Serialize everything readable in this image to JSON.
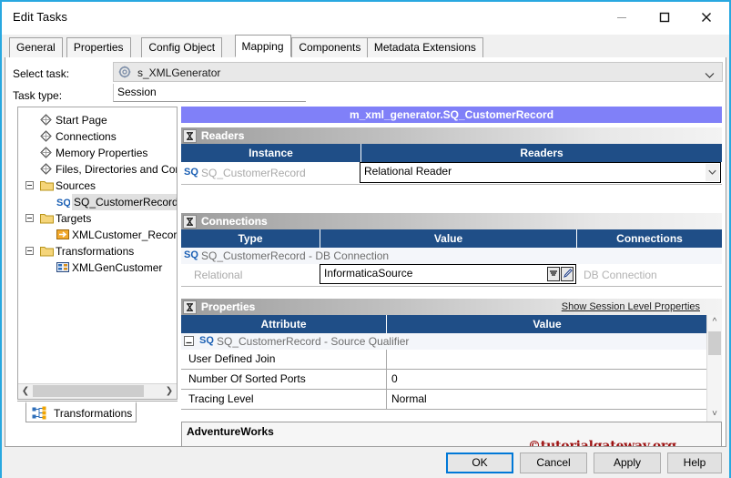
{
  "window": {
    "title": "Edit Tasks",
    "controls": {
      "minimize": "Minimize",
      "maximize": "Maximize",
      "close": "Close"
    }
  },
  "tabs": [
    {
      "label": "General",
      "active": false
    },
    {
      "label": "Properties",
      "active": false
    },
    {
      "label": "Config Object",
      "active": false
    },
    {
      "label": "Mapping",
      "active": true
    },
    {
      "label": "Components",
      "active": false
    },
    {
      "label": "Metadata Extensions",
      "active": false
    }
  ],
  "form": {
    "select_task_label": "Select task:",
    "select_task_value": "s_XMLGenerator",
    "task_type_label": "Task type:",
    "task_type_value": "Session"
  },
  "tree": {
    "items": [
      {
        "label": "Start Page",
        "indent": 0,
        "icon": "diamond-icon",
        "expander": false,
        "selected": false
      },
      {
        "label": "Connections",
        "indent": 0,
        "icon": "diamond-icon",
        "expander": false,
        "selected": false
      },
      {
        "label": "Memory Properties",
        "indent": 0,
        "icon": "diamond-icon",
        "expander": false,
        "selected": false
      },
      {
        "label": "Files, Directories and Com",
        "indent": 0,
        "icon": "diamond-icon",
        "expander": false,
        "selected": false
      },
      {
        "label": "Sources",
        "indent": 0,
        "icon": "folder-icon",
        "expander": true,
        "selected": false
      },
      {
        "label": "SQ_CustomerRecord",
        "indent": 1,
        "icon": "sq-icon",
        "expander": false,
        "selected": true
      },
      {
        "label": "Targets",
        "indent": 0,
        "icon": "folder-icon",
        "expander": true,
        "selected": false
      },
      {
        "label": "XMLCustomer_Record",
        "indent": 1,
        "icon": "target-icon",
        "expander": false,
        "selected": false
      },
      {
        "label": "Transformations",
        "indent": 0,
        "icon": "folder-icon",
        "expander": true,
        "selected": false
      },
      {
        "label": "XMLGenCustomer",
        "indent": 1,
        "icon": "transform-icon",
        "expander": false,
        "selected": false
      }
    ],
    "bottom_tab": "Transformations"
  },
  "mapping": {
    "title": "m_xml_generator.SQ_CustomerRecord",
    "readers": {
      "section_title": "Readers",
      "columns": [
        "Instance",
        "Readers"
      ],
      "rows": [
        {
          "instance": "SQ_CustomerRecord",
          "reader": "Relational Reader"
        }
      ]
    },
    "connections": {
      "section_title": "Connections",
      "columns": [
        "Type",
        "Value",
        "Connections"
      ],
      "group_label": "SQ_CustomerRecord - DB Connection",
      "rows": [
        {
          "type": "Relational",
          "value": "InformaticaSource",
          "connections": "DB Connection"
        }
      ]
    },
    "properties": {
      "section_title": "Properties",
      "show_session_link": "Show Session Level Properties",
      "columns": [
        "Attribute",
        "Value"
      ],
      "group_label": "SQ_CustomerRecord - Source Qualifier",
      "rows": [
        {
          "attribute": "User Defined Join",
          "value": ""
        },
        {
          "attribute": "Number Of Sorted Ports",
          "value": "0"
        },
        {
          "attribute": "Tracing Level",
          "value": "Normal"
        }
      ]
    },
    "bottom": {
      "label": "AdventureWorks",
      "watermark": "©tutorialgateway.org"
    }
  },
  "footer": {
    "buttons": [
      {
        "label": "OK",
        "primary": true
      },
      {
        "label": "Cancel",
        "primary": false
      },
      {
        "label": "Apply",
        "primary": false
      },
      {
        "label": "Help",
        "primary": false
      }
    ]
  },
  "colors": {
    "window_border": "#29a8e0",
    "mapping_title_bg": "#8080f8",
    "column_header_bg": "#1f4e87",
    "watermark": "#9c1111",
    "focus_border": "#0078d7"
  }
}
